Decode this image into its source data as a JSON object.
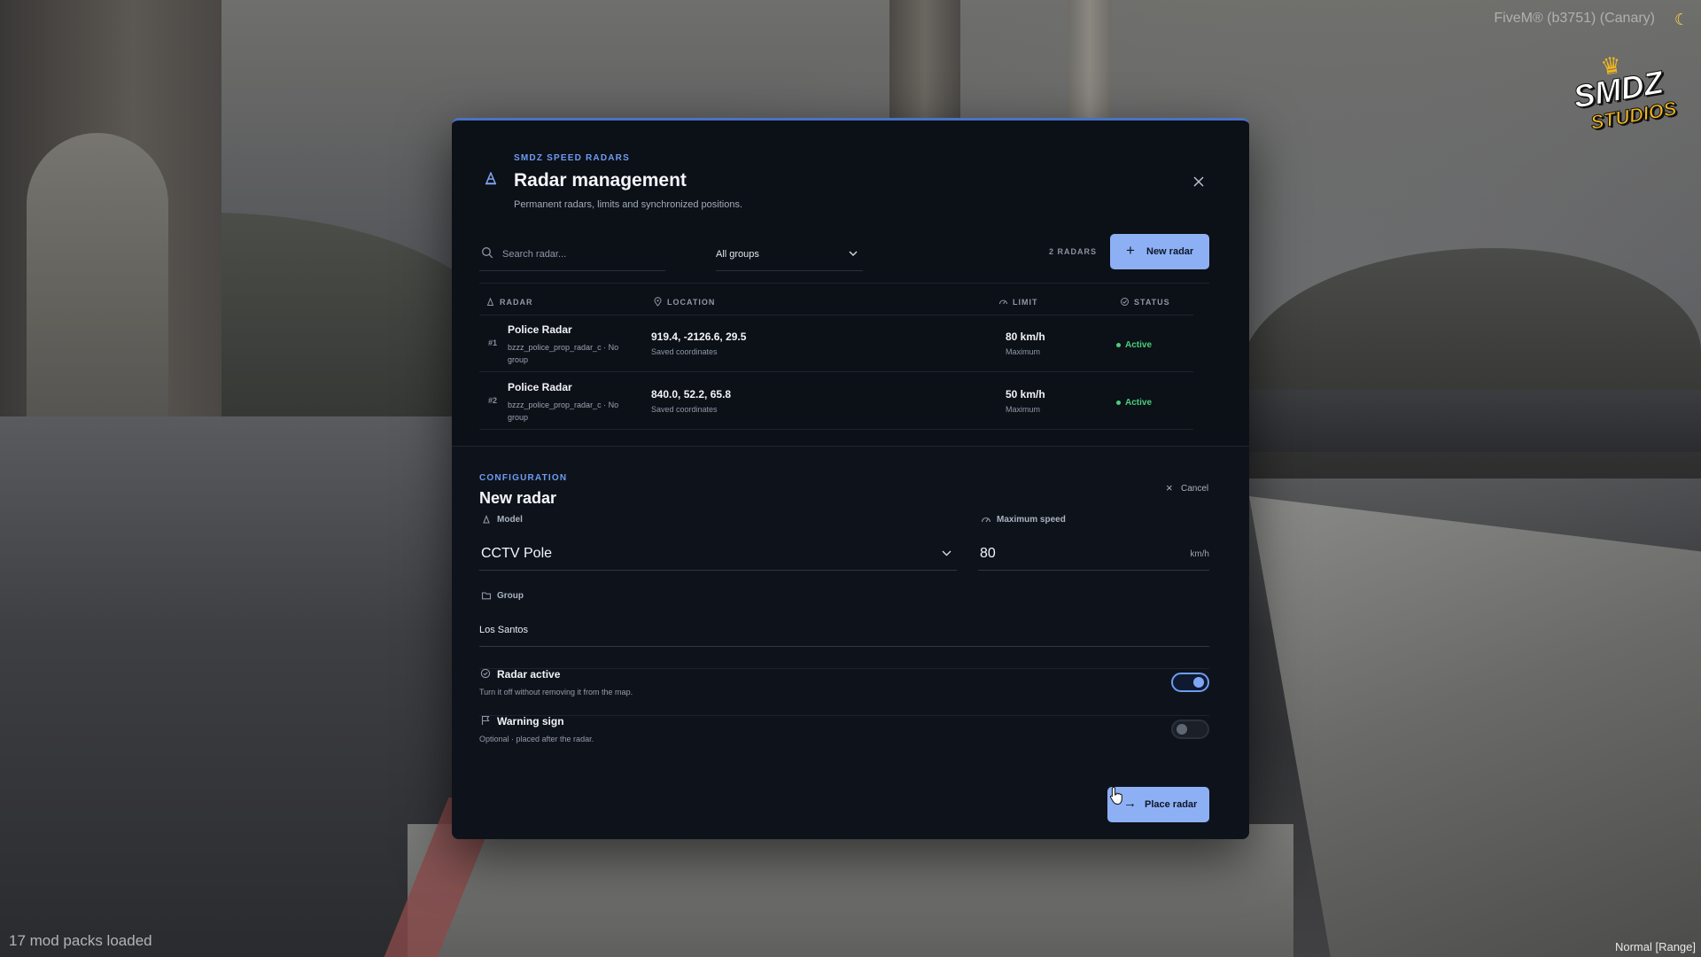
{
  "hud": {
    "build": "FiveM® (b3751) (Canary)",
    "mods_loaded": "17 mod packs loaded",
    "mode": "Normal [Range]"
  },
  "logo": {
    "line1": "SMDZ",
    "line2": "STUDIOS"
  },
  "modal": {
    "eyebrow": "SMDZ SPEED RADARS",
    "title": "Radar management",
    "subtitle": "Permanent radars, limits and synchronized positions.",
    "search_placeholder": "Search radar...",
    "group_filter": "All groups",
    "count": "2 RADARS",
    "new_button": "New radar",
    "columns": {
      "radar": "RADAR",
      "location": "LOCATION",
      "limit": "LIMIT",
      "status": "STATUS"
    },
    "rows": [
      {
        "index": "#1",
        "name": "Police Radar",
        "meta": "bzzz_police_prop_radar_c · No group",
        "coords": "919.4, -2126.6, 29.5",
        "coords_sub": "Saved coordinates",
        "limit": "80 km/h",
        "limit_sub": "Maximum",
        "status": "Active"
      },
      {
        "index": "#2",
        "name": "Police Radar",
        "meta": "bzzz_police_prop_radar_c · No group",
        "coords": "840.0, 52.2, 65.8",
        "coords_sub": "Saved coordinates",
        "limit": "50 km/h",
        "limit_sub": "Maximum",
        "status": "Active"
      }
    ]
  },
  "config": {
    "eyebrow": "CONFIGURATION",
    "title": "New radar",
    "cancel": "Cancel",
    "model_label": "Model",
    "model_value": "CCTV Pole",
    "speed_label": "Maximum speed",
    "speed_value": "80",
    "speed_unit": "km/h",
    "group_label": "Group",
    "group_value": "Los Santos",
    "radar_active": {
      "title": "Radar active",
      "subtitle": "Turn it off without removing it from the map.",
      "on": true
    },
    "warning_sign": {
      "title": "Warning sign",
      "subtitle": "Optional · placed after the radar.",
      "on": false
    },
    "place_button": "Place radar"
  },
  "colors": {
    "accent": "#8db0f5",
    "accent_text": "#6d9cf3",
    "active_status": "#49d07b",
    "panel": "#0c1017"
  }
}
